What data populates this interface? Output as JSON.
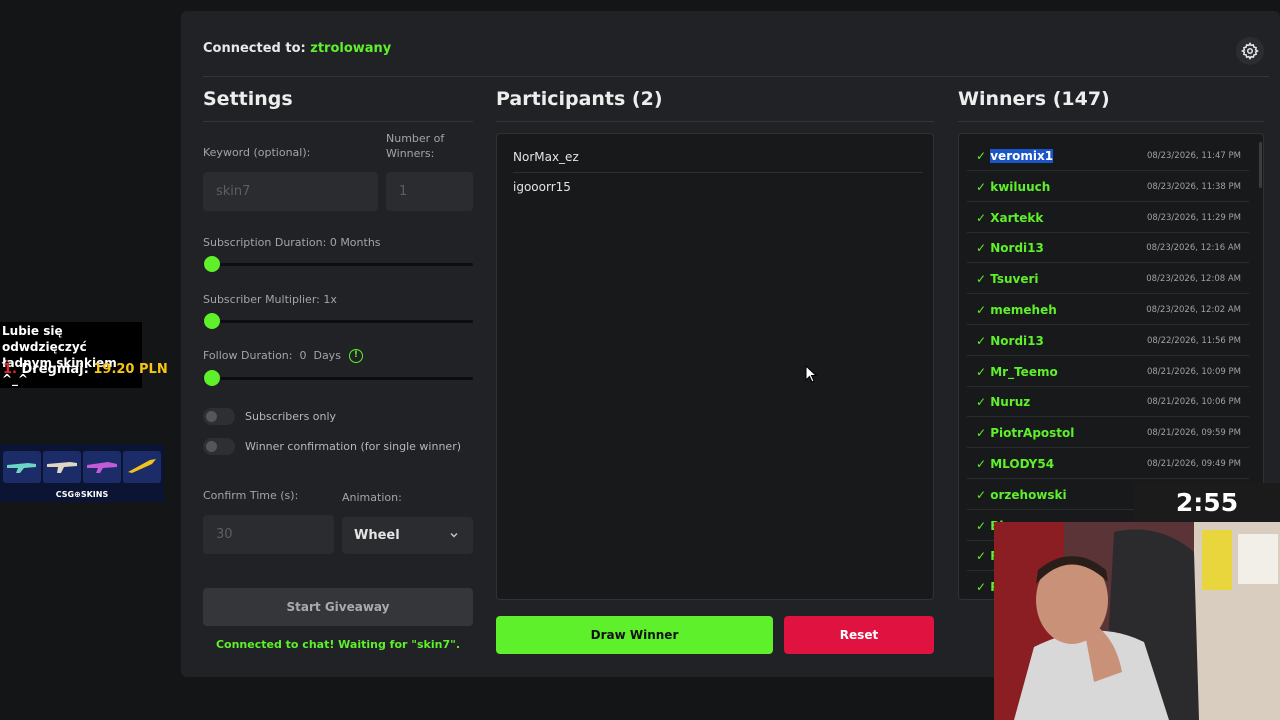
{
  "header": {
    "connected_prefix": "Connected to:",
    "channel": "ztrolowany"
  },
  "settings": {
    "title": "Settings",
    "keyword_label": "Keyword (optional):",
    "keyword_placeholder": "skin7",
    "winners_label_1": "Number of",
    "winners_label_2": "Winners:",
    "winners_placeholder": "1",
    "subscription_duration_label": "Subscription Duration: 0 Months",
    "subscription_duration_value": 0,
    "subscriber_multiplier_label": "Subscriber Multiplier: 1x",
    "subscriber_multiplier_value": 1,
    "follow_duration_label": "Follow Duration:  0  Days",
    "follow_duration_value": 0,
    "subscribers_only_label": "Subscribers only",
    "subscribers_only_on": false,
    "winner_confirmation_label": "Winner confirmation (for single winner)",
    "winner_confirmation_on": false,
    "confirm_time_label": "Confirm Time (s):",
    "confirm_time_placeholder": "30",
    "animation_label": "Animation:",
    "animation_value": "Wheel",
    "start_button": "Start Giveaway",
    "status": "Connected to chat! Waiting for \"skin7\"."
  },
  "participants": {
    "title": "Participants (2)",
    "items": [
      "NorMax_ez",
      "igooorr15"
    ],
    "draw_button": "Draw Winner",
    "reset_button": "Reset"
  },
  "winners": {
    "title": "Winners (147)",
    "items": [
      {
        "name": "veromix1",
        "date": "08/23/2026, 11:47 PM",
        "highlighted": true
      },
      {
        "name": "kwiluuch",
        "date": "08/23/2026, 11:38 PM"
      },
      {
        "name": "Xartekk",
        "date": "08/23/2026, 11:29 PM"
      },
      {
        "name": "Nordi13",
        "date": "08/23/2026, 12:16 AM"
      },
      {
        "name": "Tsuveri",
        "date": "08/23/2026, 12:08 AM"
      },
      {
        "name": "memeheh",
        "date": "08/23/2026, 12:02 AM"
      },
      {
        "name": "Nordi13",
        "date": "08/22/2026, 11:56 PM"
      },
      {
        "name": "Mr_Teemo",
        "date": "08/21/2026, 10:09 PM"
      },
      {
        "name": "Nuruz",
        "date": "08/21/2026, 10:06 PM"
      },
      {
        "name": "PiotrApostol",
        "date": "08/21/2026, 09:59 PM"
      },
      {
        "name": "MLODY54",
        "date": "08/21/2026, 09:49 PM"
      },
      {
        "name": "orzehowski",
        "date": ""
      },
      {
        "name": "Bl",
        "date": ""
      },
      {
        "name": "R",
        "date": ""
      },
      {
        "name": "R",
        "date": ""
      }
    ]
  },
  "overlay": {
    "message_line1": "Lubie się odwdzięczyć",
    "message_line2": "ładnym skinkiem ^_^",
    "donor_rank": "1.",
    "donor_name": "Dregmaj:",
    "donor_amount": "19.20 PLN",
    "banner_label": "CSG⊕SKINS",
    "timer": "2:55"
  },
  "colors": {
    "accent_green": "#5ef02a",
    "reset_red": "#e0123f",
    "highlight_blue": "#1a56c8"
  }
}
